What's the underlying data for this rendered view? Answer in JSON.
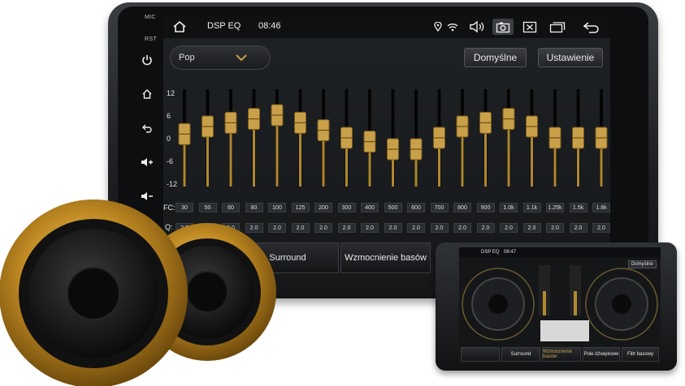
{
  "sidebar": {
    "mic_label": "MIC",
    "rst_label": "RST",
    "icons": [
      "power-icon",
      "home-icon",
      "back-icon",
      "volume-up-icon",
      "volume-down-icon"
    ]
  },
  "statusbar": {
    "title": "DSP EQ",
    "time": "08:46",
    "icons": [
      "home-icon",
      "location-icon",
      "wifi-icon",
      "speaker-icon",
      "camera-icon",
      "close-box-icon",
      "windows-icon",
      "back-arrow-icon"
    ]
  },
  "preset": {
    "value": "Pop"
  },
  "buttons": {
    "default_label": "Domyślne",
    "settings_label": "Ustawienie"
  },
  "eq": {
    "y_ticks": [
      "12",
      "6",
      "0",
      "-6",
      "-12"
    ],
    "fc_label": "FC:",
    "q_label": "Q:",
    "bands": [
      {
        "fc": "30",
        "q": "2.0",
        "gain": 1
      },
      {
        "fc": "50",
        "q": "2.0",
        "gain": 3
      },
      {
        "fc": "60",
        "q": "2.0",
        "gain": 4
      },
      {
        "fc": "80",
        "q": "2.0",
        "gain": 5
      },
      {
        "fc": "100",
        "q": "2.0",
        "gain": 6
      },
      {
        "fc": "125",
        "q": "2.0",
        "gain": 4
      },
      {
        "fc": "200",
        "q": "2.0",
        "gain": 2
      },
      {
        "fc": "300",
        "q": "2.0",
        "gain": 0
      },
      {
        "fc": "400",
        "q": "2.0",
        "gain": -1
      },
      {
        "fc": "500",
        "q": "2.0",
        "gain": -3
      },
      {
        "fc": "600",
        "q": "2.0",
        "gain": -3
      },
      {
        "fc": "700",
        "q": "2.0",
        "gain": 0
      },
      {
        "fc": "800",
        "q": "2.0",
        "gain": 3
      },
      {
        "fc": "900",
        "q": "2.0",
        "gain": 4
      },
      {
        "fc": "1.0k",
        "q": "2.0",
        "gain": 5
      },
      {
        "fc": "1.1k",
        "q": "2.0",
        "gain": 3
      },
      {
        "fc": "1.25k",
        "q": "2.0",
        "gain": 0
      },
      {
        "fc": "1.5k",
        "q": "2.0",
        "gain": 0
      },
      {
        "fc": "1.8k",
        "q": "2.0",
        "gain": 0
      }
    ]
  },
  "tabs": {
    "surround": "Surround",
    "bass_boost": "Wzmocnienie basów"
  },
  "tablet": {
    "title": "DSP EQ",
    "time": "08:47",
    "default_button": "Domyślne",
    "tabs": [
      "Surround",
      "Wzmocnienie basów",
      "Pole dźwiękowe",
      "Filtr basowy"
    ]
  },
  "colors": {
    "accent_gold": "#c9a04a",
    "slider_fill": "#b08830",
    "bg_dark": "#151719"
  }
}
